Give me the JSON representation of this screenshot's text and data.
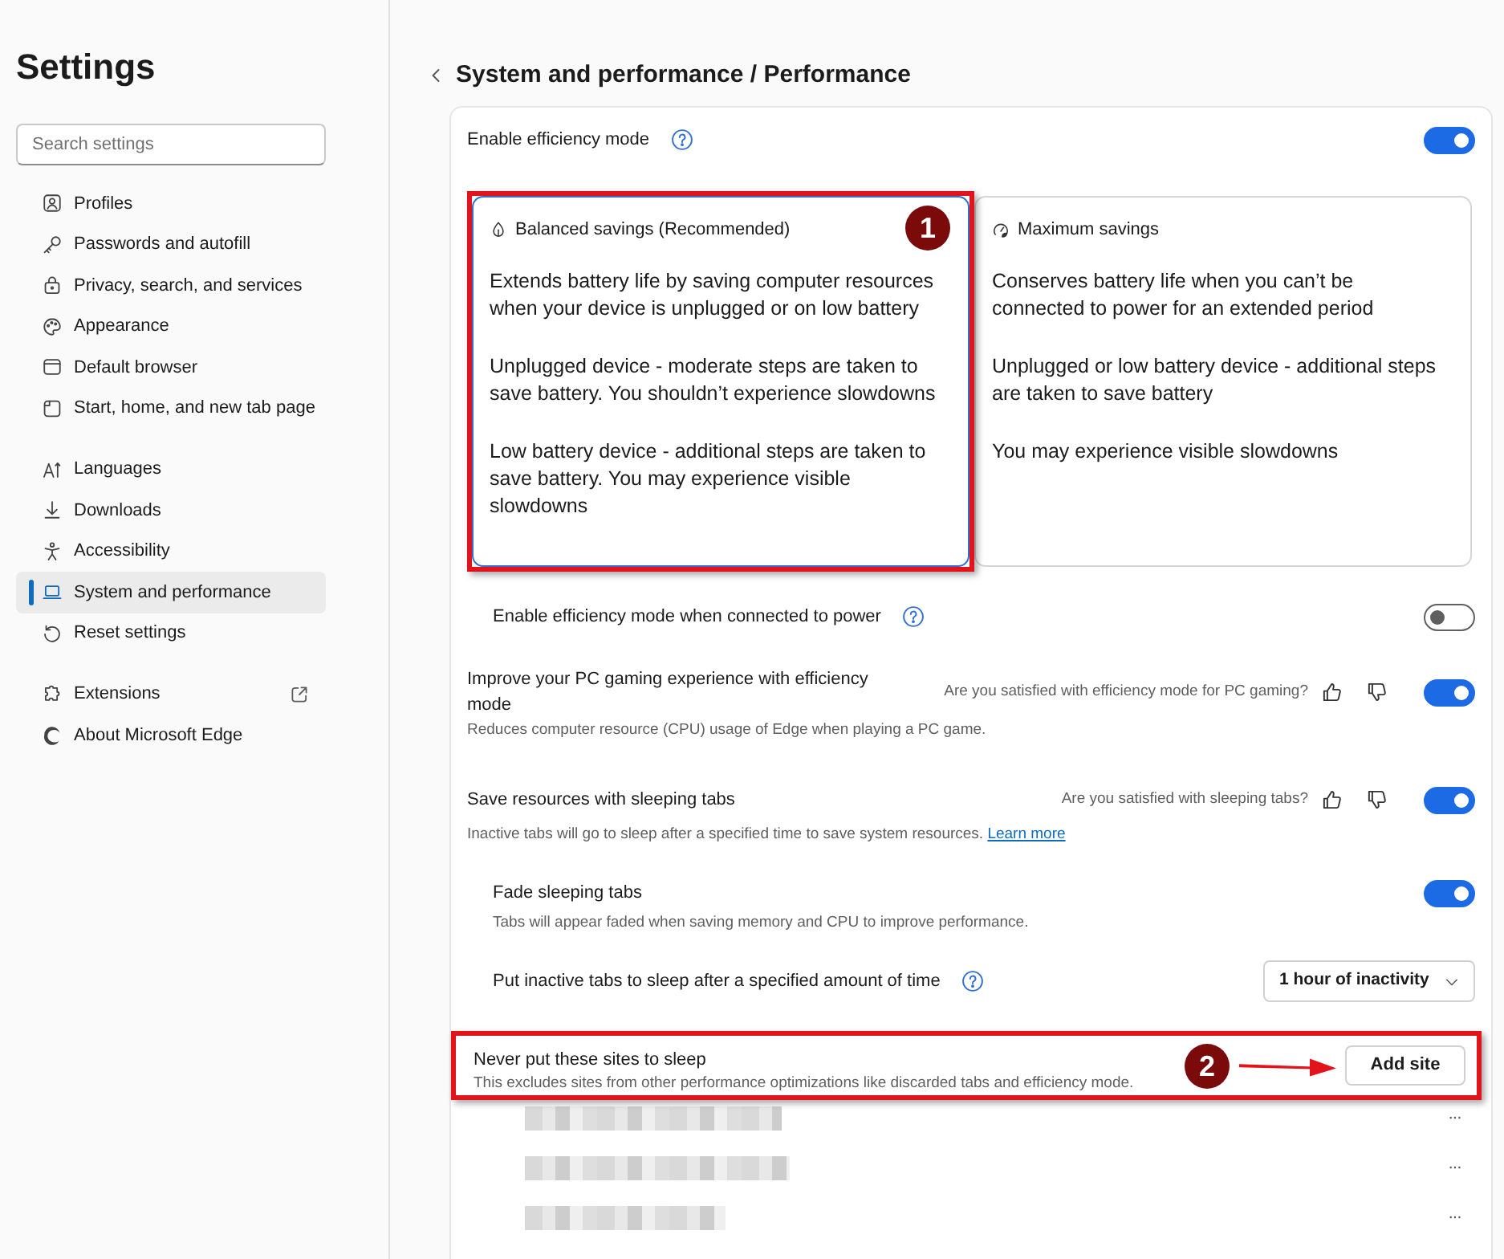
{
  "sidebar": {
    "title": "Settings",
    "search": {
      "placeholder": "Search settings"
    },
    "sections": [
      {
        "items": [
          {
            "label": "Profiles",
            "selected": false,
            "external": false
          },
          {
            "label": "Passwords and autofill",
            "selected": false,
            "external": false
          },
          {
            "label": "Privacy, search, and services",
            "selected": false,
            "external": false
          },
          {
            "label": "Appearance",
            "selected": false,
            "external": false
          },
          {
            "label": "Default browser",
            "selected": false,
            "external": false
          },
          {
            "label": "Start, home, and new tab page",
            "selected": false,
            "external": false
          }
        ]
      },
      {
        "items": [
          {
            "label": "Languages",
            "selected": false,
            "external": false
          },
          {
            "label": "Downloads",
            "selected": false,
            "external": false
          },
          {
            "label": "Accessibility",
            "selected": false,
            "external": false
          },
          {
            "label": "System and performance",
            "selected": true,
            "external": false
          },
          {
            "label": "Reset settings",
            "selected": false,
            "external": false
          }
        ]
      },
      {
        "items": [
          {
            "label": "Extensions",
            "selected": false,
            "external": true
          },
          {
            "label": "About Microsoft Edge",
            "selected": false,
            "external": false
          }
        ]
      }
    ]
  },
  "header": {
    "title": "System and performance / Performance"
  },
  "rows": [
    {
      "kind": "toggle",
      "label": "Enable efficiency mode",
      "help": true,
      "on": true,
      "options": [
        {
          "title": "Balanced savings (Recommended)",
          "selected": true,
          "callout": "1",
          "paragraphs": [
            "Extends battery life by saving computer resources when your device is unplugged or on low battery",
            "Unplugged device - moderate steps are taken to save battery. You shouldn’t experience slowdowns",
            "Low battery device - additional steps are taken to save battery. You may experience visible slowdowns"
          ]
        },
        {
          "title": "Maximum savings",
          "selected": false,
          "paragraphs": [
            "Conserves battery life when you can’t be connected to power for an extended period",
            "Unplugged or low battery device - additional steps are taken to save battery",
            "You may experience visible slowdowns"
          ]
        }
      ],
      "children": [
        {
          "kind": "toggle",
          "label": "Enable efficiency mode when connected to power",
          "help": true,
          "on": false
        }
      ]
    },
    {
      "kind": "toggle",
      "label": "Improve your PC gaming experience with efficiency mode",
      "description": "Reduces computer resource (CPU) usage of Edge when playing a PC game.",
      "feedback": "Are you satisfied with efficiency mode for PC gaming?",
      "on": true
    },
    {
      "kind": "toggle",
      "label": "Save resources with sleeping tabs",
      "description": "Inactive tabs will go to sleep after a specified time to save system resources.",
      "link": "Learn more",
      "feedback": "Are you satisfied with sleeping tabs?",
      "on": true,
      "children": [
        {
          "kind": "toggle",
          "label": "Fade sleeping tabs",
          "description": "Tabs will appear faded when saving memory and CPU to improve performance.",
          "on": true
        },
        {
          "kind": "dropdown",
          "label": "Put inactive tabs to sleep after a specified amount of time",
          "help": true,
          "value": "1 hour of inactivity"
        }
      ]
    },
    {
      "kind": "button",
      "label": "Never put these sites to sleep",
      "description": "This excludes sites from other performance optimizations like discarded tabs and efficiency mode.",
      "button": "Add site",
      "callout": "2",
      "sites": [
        {
          "menu": "···"
        },
        {
          "menu": "···"
        },
        {
          "menu": "···"
        }
      ]
    }
  ]
}
